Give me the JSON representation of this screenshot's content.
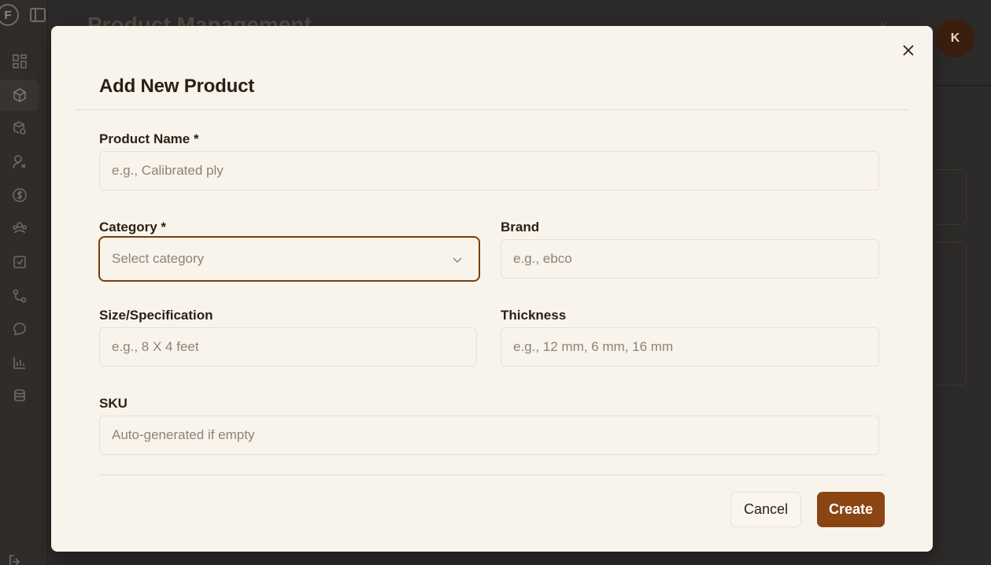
{
  "background": {
    "page_title": "Product Management",
    "user_initial": "K",
    "user_name_partial": "K",
    "logo_letter": "F",
    "sidebar_icons": [
      "dashboard-icon",
      "box-icon",
      "box-settings-icon",
      "user-icon",
      "dollar-icon",
      "users-icon",
      "checkbox-icon",
      "route-icon",
      "chat-icon",
      "bar-chart-icon",
      "database-icon"
    ]
  },
  "modal": {
    "title": "Add New Product",
    "close_icon": "close-icon",
    "fields": {
      "product_name": {
        "label": "Product Name *",
        "placeholder": "e.g., Calibrated ply",
        "value": ""
      },
      "category": {
        "label": "Category *",
        "placeholder": "Select category",
        "value": ""
      },
      "brand": {
        "label": "Brand",
        "placeholder": "e.g., ebco",
        "value": ""
      },
      "size": {
        "label": "Size/Specification",
        "placeholder": "e.g., 8 X 4 feet",
        "value": ""
      },
      "thickness": {
        "label": "Thickness",
        "placeholder": "e.g., 12 mm, 6 mm, 16 mm",
        "value": ""
      },
      "sku": {
        "label": "SKU",
        "placeholder": "Auto-generated if empty",
        "value": ""
      }
    },
    "buttons": {
      "cancel": "Cancel",
      "create": "Create"
    }
  },
  "colors": {
    "accent": "#8b4513",
    "modal_bg": "#f8f4eb",
    "focus_border": "#7a3a0c"
  }
}
